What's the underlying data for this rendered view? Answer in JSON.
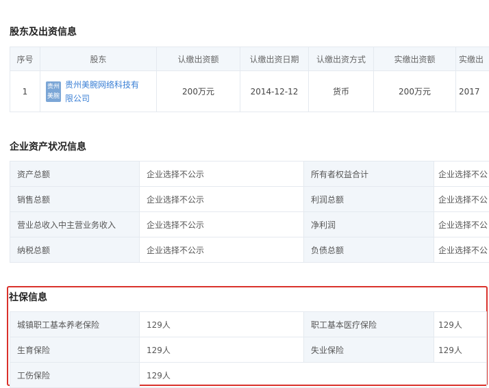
{
  "shareholders": {
    "title": "股东及出资信息",
    "headers": [
      "序号",
      "股东",
      "认缴出资额",
      "认缴出资日期",
      "认缴出资方式",
      "实缴出资额",
      "实缴出"
    ],
    "rows": [
      {
        "no": "1",
        "logo": "贵州美腕",
        "name": "贵州美腕网络科技有限公司",
        "subscribed": "200万元",
        "date": "2014-12-12",
        "method": "货币",
        "paid": "200万元",
        "paid_date": "2017"
      }
    ]
  },
  "assets": {
    "title": "企业资产状况信息",
    "rows": [
      [
        "资产总额",
        "企业选择不公示",
        "所有者权益合计",
        "企业选择不公"
      ],
      [
        "销售总额",
        "企业选择不公示",
        "利润总额",
        "企业选择不公"
      ],
      [
        "营业总收入中主营业务收入",
        "企业选择不公示",
        "净利润",
        "企业选择不公"
      ],
      [
        "纳税总额",
        "企业选择不公示",
        "负债总额",
        "企业选择不公"
      ]
    ]
  },
  "social": {
    "title": "社保信息",
    "rows": [
      [
        "城镇职工基本养老保险",
        "129人",
        "职工基本医疗保险",
        "129人"
      ],
      [
        "生育保险",
        "129人",
        "失业保险",
        "129人"
      ],
      [
        "工伤保险",
        "129人"
      ]
    ]
  }
}
